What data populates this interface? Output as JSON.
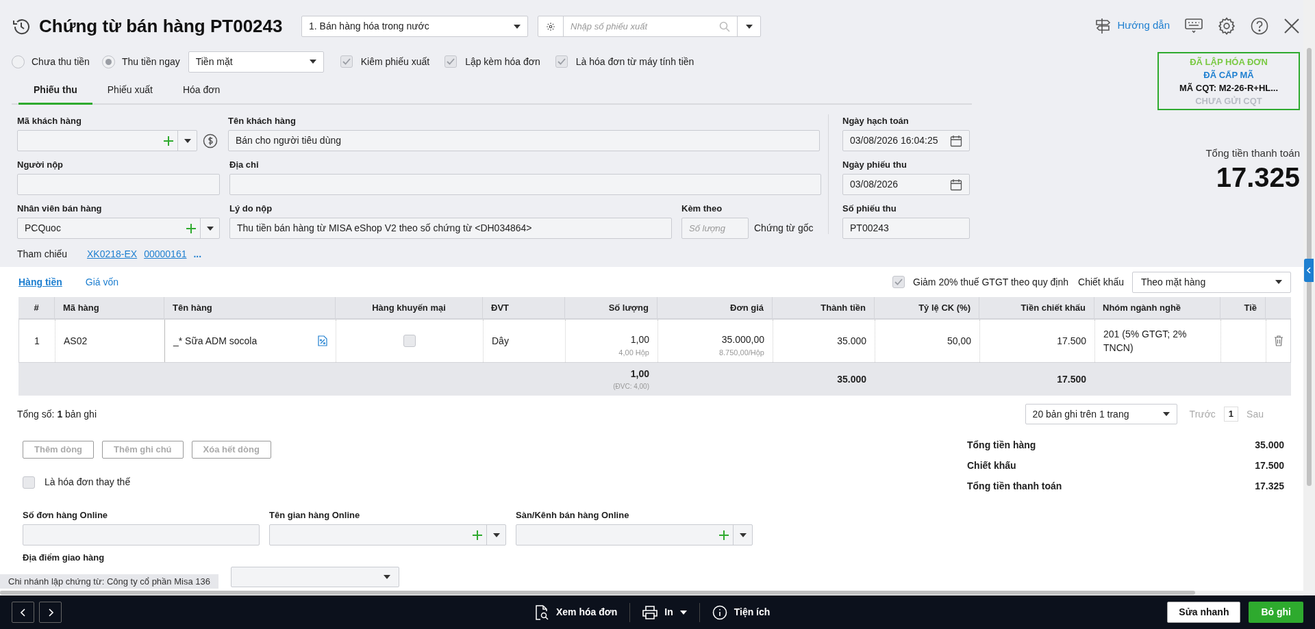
{
  "header": {
    "title": "Chứng từ bán hàng PT00243",
    "voucher_type": "1. Bán hàng hóa trong nước",
    "search_placeholder": "Nhập số phiếu xuất",
    "guide_link": "Hướng dẫn"
  },
  "payment_options": [
    {
      "label": "Chưa thu tiền",
      "selected": false
    },
    {
      "label": "Thu tiền ngay",
      "selected": true
    }
  ],
  "payment_method": "Tiền mặt",
  "options": [
    {
      "label": "Kiêm phiếu xuất",
      "checked": true
    },
    {
      "label": "Lập kèm hóa đơn",
      "checked": true
    },
    {
      "label": "Là hóa đơn từ máy tính tiền",
      "checked": true
    }
  ],
  "status_box": {
    "lines": [
      {
        "text": "ĐÃ LẬP HÓA ĐƠN",
        "color": "#7ac943"
      },
      {
        "text": "ĐÃ CẤP MÃ",
        "color": "#1e7fd0"
      },
      {
        "text": "MÃ CQT: M2-26-R+HL...",
        "color": "#111111"
      },
      {
        "text": "CHƯA GỬI CQT",
        "color": "#b8bcc4"
      }
    ]
  },
  "tabs": [
    {
      "label": "Phiếu thu",
      "selected": true
    },
    {
      "label": "Phiếu xuất",
      "selected": false
    },
    {
      "label": "Hóa đơn",
      "selected": false
    }
  ],
  "form": {
    "customer_code": {
      "label": "Mã khách hàng"
    },
    "customer_name": {
      "label": "Tên khách hàng",
      "value": "Bán cho người tiêu dùng"
    },
    "payer": {
      "label": "Người nộp"
    },
    "address": {
      "label": "Địa chỉ"
    },
    "salesperson": {
      "label": "Nhân viên bán hàng",
      "value": "PCQuoc"
    },
    "reason": {
      "label": "Lý do nộp",
      "value": "Thu tiền bán hàng từ MISA eShop V2 theo số chứng từ <DH034864>"
    },
    "attached": {
      "label": "Kèm theo",
      "placeholder": "Số lượng",
      "suffix": "Chứng từ gốc"
    },
    "posting_date": {
      "label": "Ngày hạch toán",
      "value": "03/08/2026 16:04:25"
    },
    "receipt_date": {
      "label": "Ngày phiếu thu",
      "value": "03/08/2026"
    },
    "receipt_no": {
      "label": "Số phiếu thu",
      "value": "PT00243"
    },
    "reference": {
      "label": "Tham chiếu",
      "links": [
        "XK0218-EX",
        "00000161"
      ],
      "more": "..."
    }
  },
  "total": {
    "label": "Tổng tiền thanh toán",
    "value": "17.325"
  },
  "detail_tabs": [
    {
      "label": "Hàng tiền",
      "selected": true
    },
    {
      "label": "Giá vốn",
      "selected": false
    }
  ],
  "vat_reduction": {
    "label": "Giảm 20% thuế GTGT theo quy định",
    "checked": true
  },
  "discount": {
    "label": "Chiết khấu",
    "value": "Theo mặt hàng"
  },
  "table": {
    "columns": [
      "#",
      "Mã hàng",
      "Tên hàng",
      "Hàng khuyến mại",
      "ĐVT",
      "Số lượng",
      "Đơn giá",
      "Thành tiền",
      "Tỷ lệ CK (%)",
      "Tiền chiết khấu",
      "Nhóm ngành nghề",
      "Tiề"
    ],
    "rows": [
      {
        "no": "1",
        "code": "AS02",
        "name": "_* Sữa ADM socola",
        "promo": false,
        "unit": "Dây",
        "qty": "1,00",
        "qty_sub": "4,00 Hộp",
        "price": "35.000,00",
        "price_sub": "8.750,00/Hộp",
        "amount": "35.000",
        "discount_rate": "50,00",
        "discount_amount": "17.500",
        "industry": "201 (5% GTGT; 2% TNCN)"
      }
    ],
    "footer": {
      "qty": "1,00",
      "qty_sub": "(ĐVC: 4,00)",
      "amount": "35.000",
      "discount_amount": "17.500"
    }
  },
  "record_count": "Tổng số: **1** bản ghi",
  "pager": {
    "page_size": "20 bản ghi trên 1 trang",
    "prev": "Trước",
    "page": "1",
    "next": "Sau"
  },
  "row_buttons": [
    "Thêm dòng",
    "Thêm ghi chú",
    "Xóa hết dòng"
  ],
  "replacement_invoice": {
    "label": "Là hóa đơn thay thế",
    "checked": false
  },
  "summary": [
    {
      "label": "Tổng tiền hàng",
      "value": "35.000"
    },
    {
      "label": "Chiết khấu",
      "value": "17.500"
    },
    {
      "label": "Tổng tiền thanh toán",
      "value": "17.325"
    }
  ],
  "online": [
    {
      "label": "Số đơn hàng Online",
      "kind": "text"
    },
    {
      "label": "Tên gian hàng Online",
      "kind": "combo"
    },
    {
      "label": "Sàn/Kênh bán hàng Online",
      "kind": "combo"
    }
  ],
  "delivery": {
    "label": "Địa điểm giao hàng"
  },
  "branch": "Chi nhánh lập chứng từ: Công ty cổ phần Misa 136",
  "toolbar": {
    "view_invoice": "Xem hóa đơn",
    "print": "In",
    "utilities": "Tiện ích",
    "quick_edit": "Sửa nhanh",
    "cancel_post": "Bỏ ghi"
  }
}
